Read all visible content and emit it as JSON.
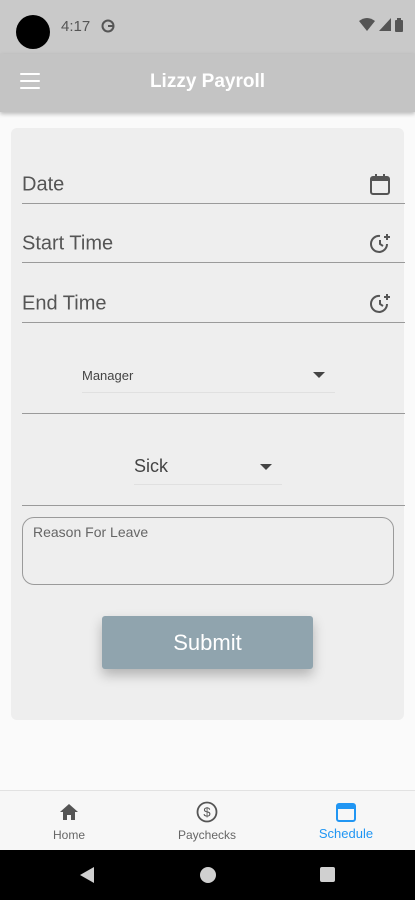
{
  "status_bar": {
    "time": "4:17",
    "icons": [
      "camera-dot",
      "g-icon",
      "wifi-icon",
      "signal-icon",
      "battery-icon"
    ]
  },
  "app_bar": {
    "title": "Lizzy Payroll",
    "menu_icon": "hamburger-menu-icon"
  },
  "form": {
    "date_label": "Date",
    "date_icon": "calendar-icon",
    "start_time_label": "Start Time",
    "start_time_icon": "clock-plus-icon",
    "end_time_label": "End Time",
    "end_time_icon": "clock-plus-icon",
    "manager_dropdown": {
      "value": "Manager"
    },
    "leave_type_dropdown": {
      "value": "Sick"
    },
    "reason": {
      "placeholder": "Reason For Leave",
      "value": ""
    },
    "submit_label": "Submit"
  },
  "bottom_nav": {
    "items": [
      {
        "label": "Home",
        "icon": "home-icon",
        "active": false
      },
      {
        "label": "Paychecks",
        "icon": "dollar-circle-icon",
        "active": false
      },
      {
        "label": "Schedule",
        "icon": "calendar-icon",
        "active": true
      }
    ]
  },
  "system_nav": [
    "back-icon",
    "home-circle-icon",
    "recents-icon"
  ],
  "colors": {
    "app_bar": "#c4c4c4",
    "card": "#eeeeee",
    "submit_button": "#90a4ae",
    "active_nav": "#2196f3"
  }
}
